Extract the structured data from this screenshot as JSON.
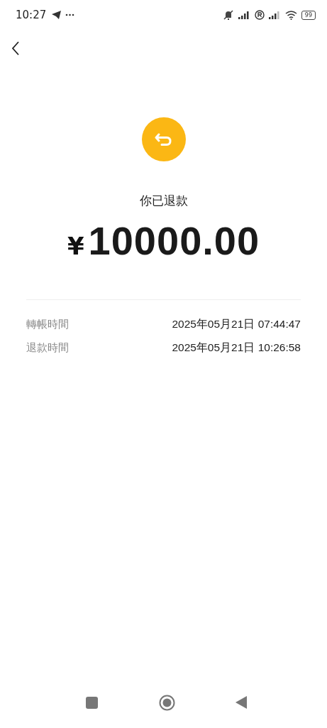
{
  "status_bar": {
    "time": "10:27",
    "battery": "99"
  },
  "status": "你已退款",
  "amount": {
    "currency": "¥",
    "value": "10000.00"
  },
  "details": [
    {
      "label": "轉帳時間",
      "value": "2025年05月21日 07:44:47"
    },
    {
      "label": "退款時間",
      "value": "2025年05月21日 10:26:58"
    }
  ]
}
